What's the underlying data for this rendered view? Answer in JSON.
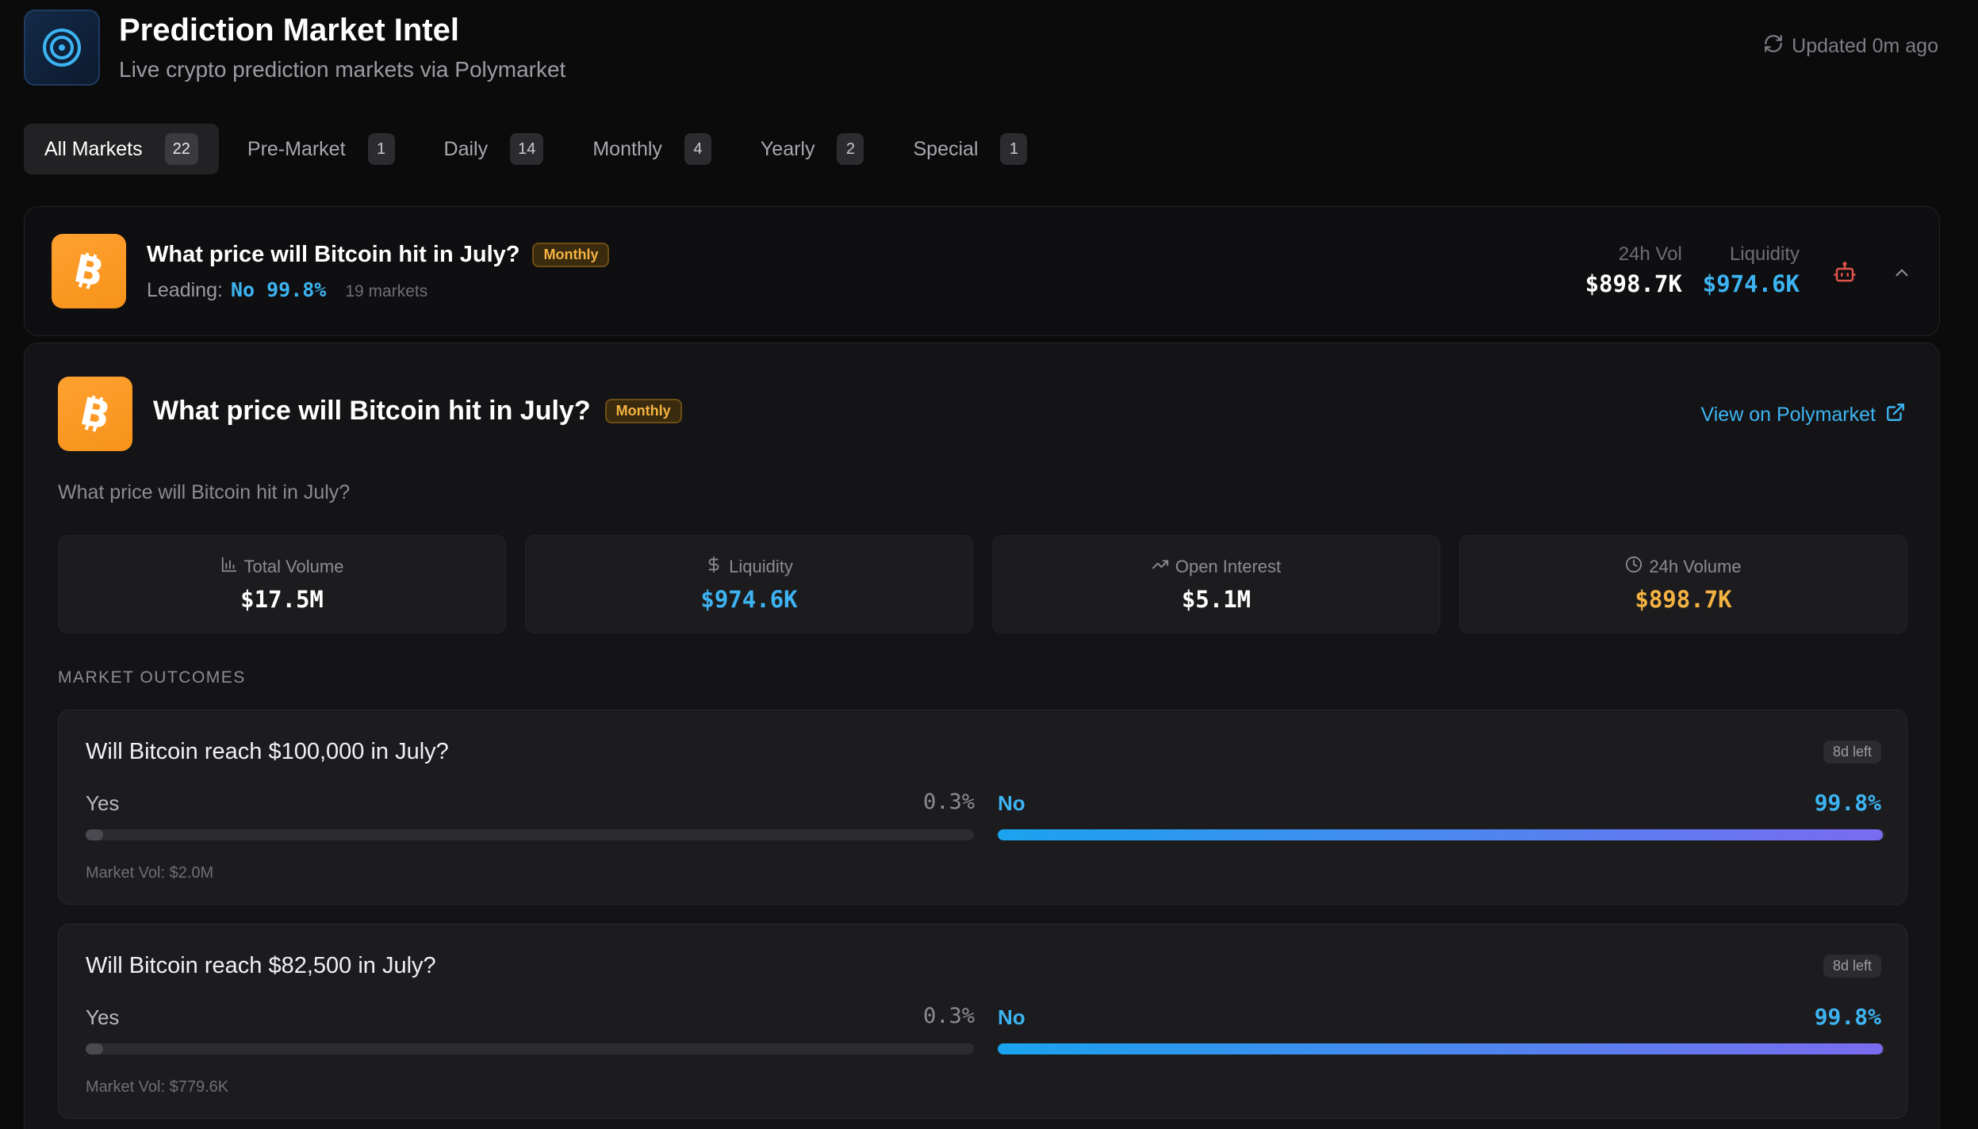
{
  "header": {
    "title": "Prediction Market Intel",
    "subtitle": "Live crypto prediction markets via Polymarket",
    "updated": "Updated 0m ago",
    "logo_icon": "target-icon",
    "refresh_icon": "refresh-icon"
  },
  "tabs": [
    {
      "label": "All Markets",
      "count": "22",
      "active": true
    },
    {
      "label": "Pre-Market",
      "count": "1",
      "active": false
    },
    {
      "label": "Daily",
      "count": "14",
      "active": false
    },
    {
      "label": "Monthly",
      "count": "4",
      "active": false
    },
    {
      "label": "Yearly",
      "count": "2",
      "active": false
    },
    {
      "label": "Special",
      "count": "1",
      "active": false
    }
  ],
  "summary": {
    "title": "What price will Bitcoin hit in July?",
    "badge": "Monthly",
    "leading_prefix": "Leading:",
    "leading_value": "No 99.8%",
    "markets": "19 markets",
    "vol_label": "24h Vol",
    "vol_value": "$898.7K",
    "liq_label": "Liquidity",
    "liq_value": "$974.6K"
  },
  "detail": {
    "title": "What price will Bitcoin hit in July?",
    "badge": "Monthly",
    "link": "View on Polymarket",
    "description": "What price will Bitcoin hit in July?",
    "stats": [
      {
        "label": "Total Volume",
        "value": "$17.5M",
        "icon": "bar-chart-icon",
        "color": "#ffffff"
      },
      {
        "label": "Liquidity",
        "value": "$974.6K",
        "icon": "dollar-icon",
        "color": "#3db4f2"
      },
      {
        "label": "Open Interest",
        "value": "$5.1M",
        "icon": "trending-up-icon",
        "color": "#ffffff"
      },
      {
        "label": "24h Volume",
        "value": "$898.7K",
        "icon": "clock-icon",
        "color": "#f5b342"
      }
    ],
    "outcomes_label": "MARKET OUTCOMES",
    "outcomes": [
      {
        "question": "Will Bitcoin reach $100,000 in July?",
        "time_left": "8d left",
        "yes_label": "Yes",
        "yes_pct": "0.3%",
        "yes_value": 0.3,
        "no_label": "No",
        "no_pct": "99.8%",
        "no_value": 99.8,
        "volume": "Market Vol: $2.0M"
      },
      {
        "question": "Will Bitcoin reach $82,500 in July?",
        "time_left": "8d left",
        "yes_label": "Yes",
        "yes_pct": "0.3%",
        "yes_value": 0.3,
        "no_label": "No",
        "no_pct": "99.8%",
        "no_value": 99.8,
        "volume": "Market Vol: $779.6K"
      }
    ]
  },
  "colors": {
    "accent": "#3db4f2",
    "bitcoin": "#f7931a",
    "badge": "#f5b342"
  }
}
